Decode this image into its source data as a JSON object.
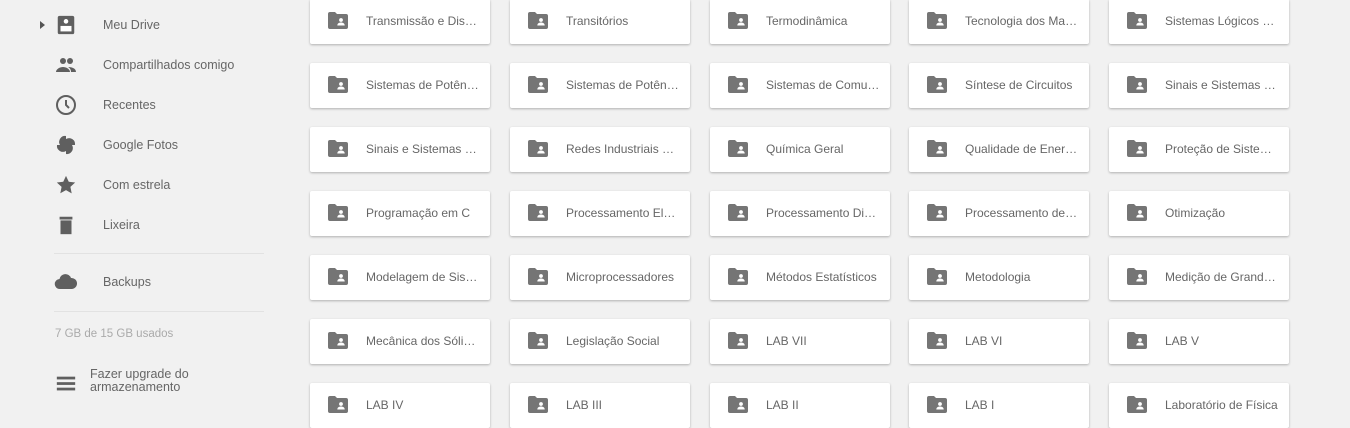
{
  "sidebar": {
    "items": [
      {
        "label": "Meu Drive",
        "icon": "drive-icon"
      },
      {
        "label": "Compartilhados comigo",
        "icon": "people-icon"
      },
      {
        "label": "Recentes",
        "icon": "clock-icon"
      },
      {
        "label": "Google Fotos",
        "icon": "pinwheel-icon"
      },
      {
        "label": "Com estrela",
        "icon": "star-icon"
      },
      {
        "label": "Lixeira",
        "icon": "trash-icon"
      }
    ],
    "backups": {
      "label": "Backups",
      "icon": "cloud-icon"
    },
    "storage": "7 GB de 15 GB usados",
    "upgrade": {
      "label": "Fazer upgrade do armazenamento",
      "icon": "storage-icon"
    }
  },
  "folders": {
    "icon": "shared-folder-icon",
    "rows": [
      [
        "Transmissão e Distribuição",
        "Transitórios",
        "Termodinâmica",
        "Tecnologia dos Materiais",
        "Sistemas Lógicos Programáveis"
      ],
      [
        "Sistemas de Potência",
        "Sistemas de Potência II",
        "Sistemas de Comunicação",
        "Síntese de Circuitos",
        "Sinais e Sistemas Lineares"
      ],
      [
        "Sinais e Sistemas Discretos",
        "Redes Industriais de Comunicação",
        "Química Geral",
        "Qualidade de Energia",
        "Proteção de Sistemas"
      ],
      [
        "Programação em C",
        "Processamento Eletrônico",
        "Processamento Digital",
        "Processamento de Sinais",
        "Otimização"
      ],
      [
        "Modelagem de Sistemas",
        "Microprocessadores",
        "Métodos Estatísticos",
        "Metodologia",
        "Medição de Grandezas"
      ],
      [
        "Mecânica dos Sólidos",
        "Legislação Social",
        "LAB VII",
        "LAB VI",
        "LAB V"
      ],
      [
        "LAB IV",
        "LAB III",
        "LAB II",
        "LAB I",
        "Laboratório de Física"
      ]
    ]
  },
  "colors": {
    "background": "#f1f1f1",
    "card": "#ffffff",
    "icon": "#757575",
    "text": "#666666"
  }
}
